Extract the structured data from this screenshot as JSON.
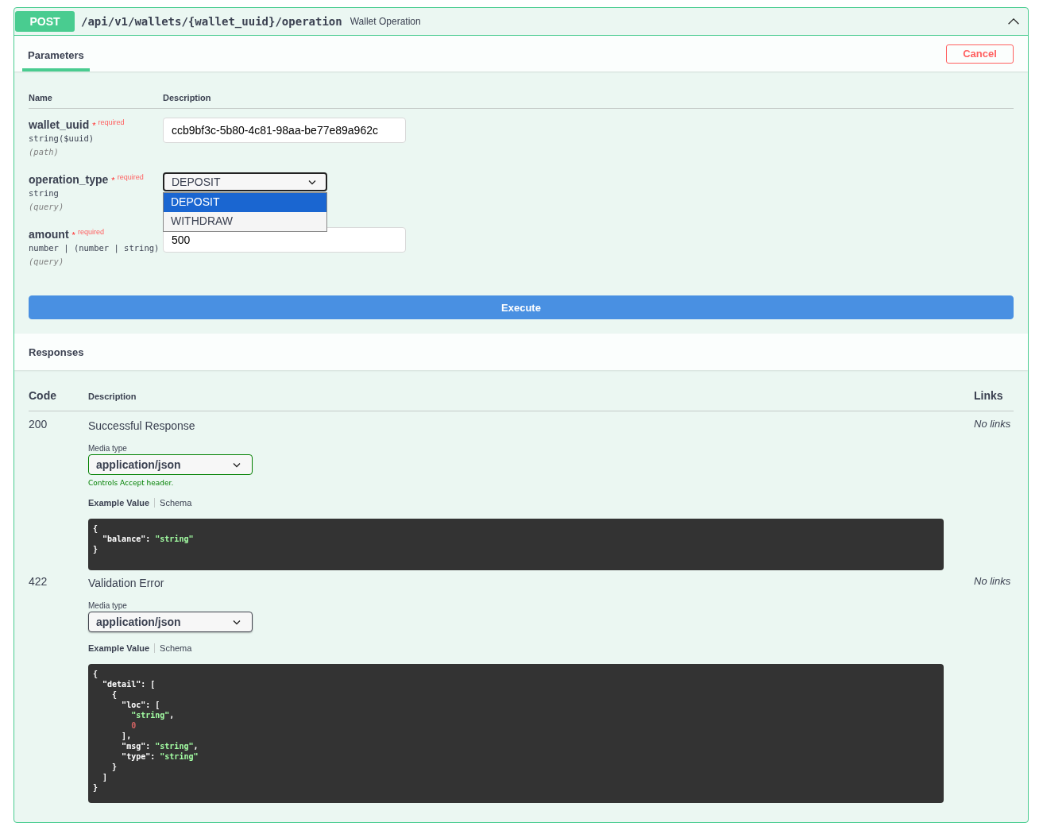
{
  "operation": {
    "method": "POST",
    "path": "/api/v1/wallets/{wallet_uuid}/operation",
    "summary": "Wallet Operation",
    "expanded": true
  },
  "tabs": [
    {
      "label": "Parameters",
      "selected": true
    }
  ],
  "cancel_button": "Cancel",
  "parameters": {
    "columns": [
      "Name",
      "Description"
    ],
    "rows": [
      {
        "name": "wallet_uuid",
        "required": "* $^{required}$",
        "type": "string($uuid)",
        "location": "(path)",
        "kind": "text",
        "value": "ccb9bf3c-5b80-4c81-98aa-be77e89a962c"
      },
      {
        "name": "operation_type",
        "required": "* $^{required}$",
        "type": "string",
        "location": "(query)",
        "kind": "select",
        "value": "DEPOSIT",
        "open": true,
        "options": [
          {
            "label": "DEPOSIT",
            "selected": true
          },
          {
            "label": "WITHDRAW",
            "selected": false
          }
        ]
      },
      {
        "name": "amount",
        "required": "* $^{required}$",
        "type": "number | (number | string)",
        "location": "(query)",
        "kind": "text",
        "value": "500"
      }
    ]
  },
  "execute_button": "Execute",
  "responses": {
    "title": "Responses",
    "columns": [
      "Code",
      "Description",
      "Links"
    ],
    "rows": [
      {
        "code": "200",
        "description": "Successful Response",
        "links": "No links",
        "media_label": "Media type",
        "media_type": "application/json",
        "media_hint": "Controls Accept header.",
        "example_tabs": [
          {
            "label": "Example Value",
            "selected": true
          },
          {
            "label": "Schema",
            "selected": false
          }
        ],
        "example": [
          [
            {
              "kind": "punct",
              "text": "{"
            }
          ],
          [
            {
              "kind": "key",
              "text": "  \"balance\""
            },
            {
              "kind": "punct",
              "text": ": "
            },
            {
              "kind": "string",
              "text": "\"string\""
            }
          ],
          [
            {
              "kind": "punct",
              "text": "}"
            }
          ]
        ]
      },
      {
        "code": "422",
        "description": "Validation Error",
        "links": "No links",
        "media_label": "Media type",
        "media_type": "application/json",
        "example_tabs": [
          {
            "label": "Example Value",
            "selected": true
          },
          {
            "label": "Schema",
            "selected": false
          }
        ],
        "example": [
          [
            {
              "kind": "punct",
              "text": "{"
            }
          ],
          [
            {
              "kind": "key",
              "text": "  \"detail\""
            },
            {
              "kind": "punct",
              "text": ": ["
            }
          ],
          [
            {
              "kind": "punct",
              "text": "    {"
            }
          ],
          [
            {
              "kind": "key",
              "text": "      \"loc\""
            },
            {
              "kind": "punct",
              "text": ": ["
            }
          ],
          [
            {
              "kind": "string",
              "text": "        \"string\""
            },
            {
              "kind": "punct",
              "text": ","
            }
          ],
          [
            {
              "kind": "number",
              "text": "        0"
            }
          ],
          [
            {
              "kind": "punct",
              "text": "      ],"
            }
          ],
          [
            {
              "kind": "key",
              "text": "      \"msg\""
            },
            {
              "kind": "punct",
              "text": ": "
            },
            {
              "kind": "string",
              "text": "\"string\""
            },
            {
              "kind": "punct",
              "text": ","
            }
          ],
          [
            {
              "kind": "key",
              "text": "      \"type\""
            },
            {
              "kind": "punct",
              "text": ": "
            },
            {
              "kind": "string",
              "text": "\"string\""
            }
          ],
          [
            {
              "kind": "punct",
              "text": "    }"
            }
          ],
          [
            {
              "kind": "punct",
              "text": "  ]"
            }
          ],
          [
            {
              "kind": "punct",
              "text": "}"
            }
          ]
        ]
      }
    ]
  }
}
